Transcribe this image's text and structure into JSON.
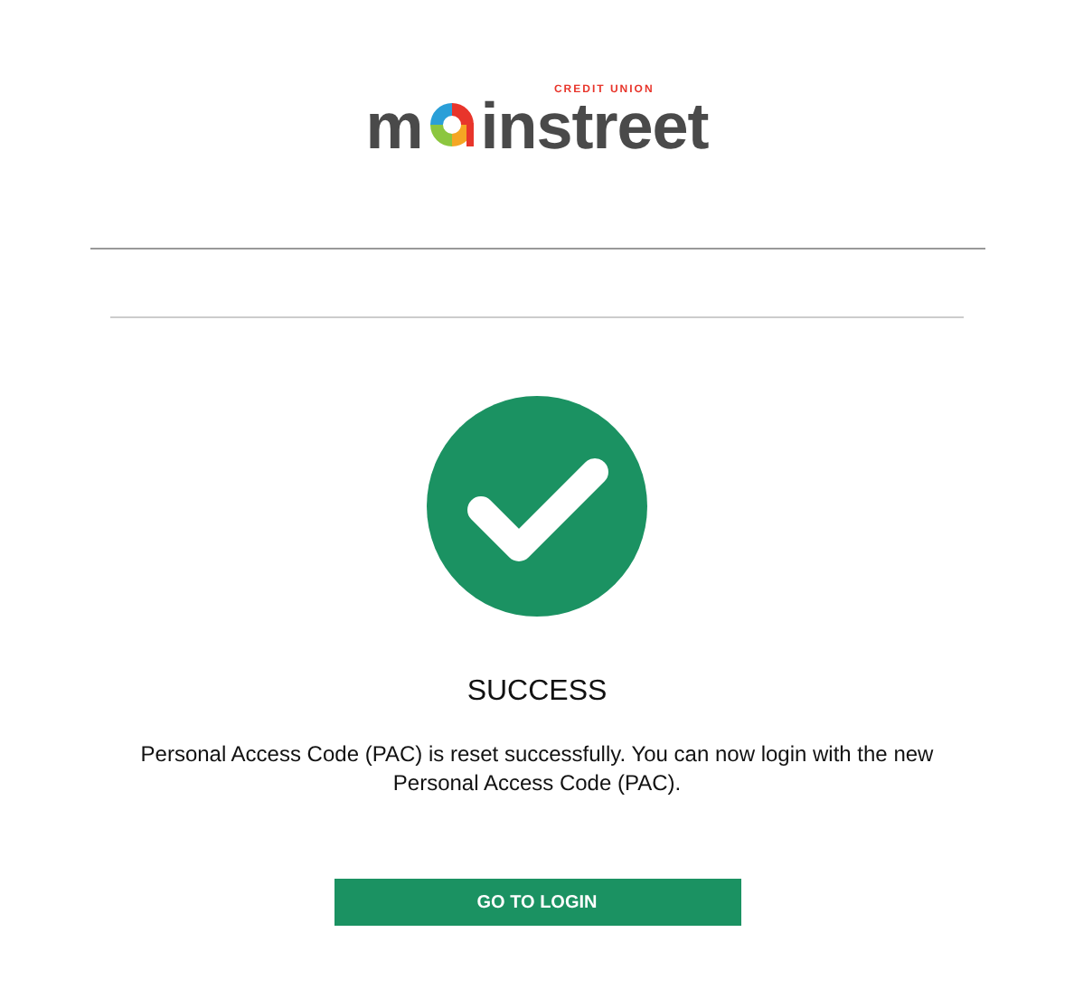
{
  "logo": {
    "tagline": "CREDIT UNION",
    "start": "m",
    "end": "instreet"
  },
  "status": {
    "kind": "success",
    "title": "SUCCESS"
  },
  "message": "Personal Access Code (PAC) is reset successfully. You can now login with the new Personal Access Code (PAC).",
  "button": "GO TO LOGIN"
}
